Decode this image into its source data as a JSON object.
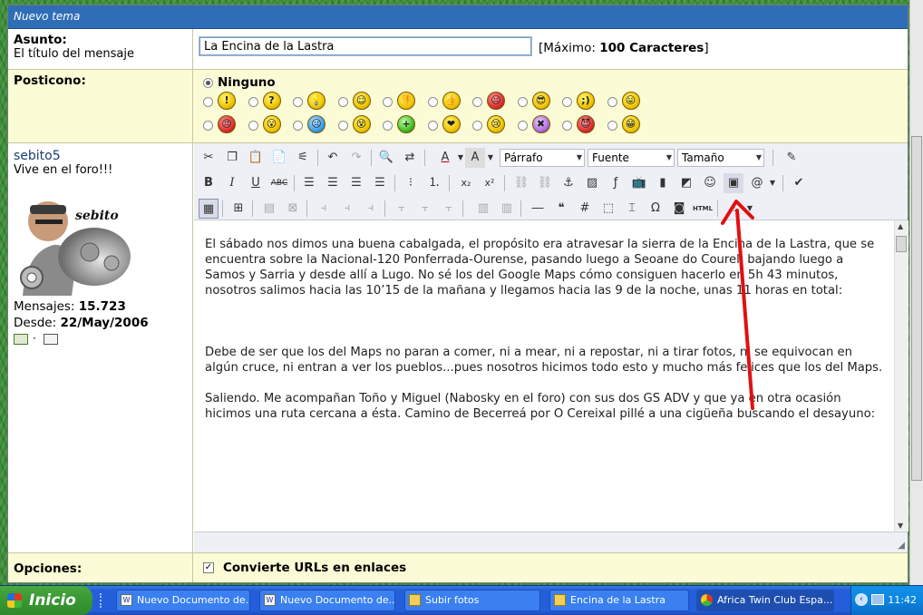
{
  "panel": {
    "title": "Nuevo tema"
  },
  "subject": {
    "label": "Asunto:",
    "sublabel": "El título del mensaje",
    "value": "La Encina de la Lastra",
    "max_prefix": "[Máximo: ",
    "max_bold": "100 Caracteres",
    "max_suffix": "]"
  },
  "posticon": {
    "label": "Posticono:",
    "none_label": "Ninguno",
    "row1": [
      "!",
      "?",
      "💡",
      "☺",
      "👎",
      "👍",
      "☹",
      "😎",
      ";)",
      "😛"
    ],
    "row2": [
      "😠",
      "😮",
      "☹",
      "😵",
      "+",
      "❤",
      "😢",
      "✖",
      "😈",
      "😁"
    ]
  },
  "user": {
    "name": "sebito5",
    "status": "Vive en el foro!!!",
    "avatar_caption": "sebito",
    "posts_label": "Mensajes: ",
    "posts_value": "15.723",
    "since_label": "Desde: ",
    "since_value": "22/May/2006",
    "separator": "·"
  },
  "toolbar": {
    "format_label": "Párrafo",
    "font_label": "Fuente",
    "size_label": "Tamaño",
    "bold": "B",
    "italic": "I",
    "underline": "U",
    "strike": "ABC",
    "html": "HTML",
    "hash": "#",
    "omega": "Ω",
    "at": "@"
  },
  "editor": {
    "paragraphs": [
      "El sábado nos dimos una buena cabalgada, el propósito era atravesar la sierra de la Encina de la Lastra, que se encuentra sobre la Nacional-120 Ponferrada-Ourense, pasando luego a Seoane do Courel, bajando luego a Samos y Sarria y desde allí a Lugo. No sé los del Google Maps cómo consiguen hacerlo en 5h 43 minutos, nosotros salimos hacia las 10’15 de la mañana y llegamos hacia las 9 de la noche, unas 11 horas en total:",
      "Debe de ser que los del Maps no paran a comer, ni a mear, ni a repostar, ni a tirar fotos, ni se equivocan en algún cruce, ni entran a ver los pueblos...pues nosotros hicimos todo esto y mucho más felices que los del Maps.",
      "Saliendo. Me acompañan Toño y Miguel (Nabosky en el foro) con sus dos GS ADV y que ya en otra ocasión hicimos una ruta cercana a ésta. Camino de Becerreá por O Cereixal pillé a una cigüeña buscando el desayuno:"
    ]
  },
  "options": {
    "label": "Opciones:",
    "convert_urls": "Convierte URLs en enlaces"
  },
  "taskbar": {
    "start": "Inicio",
    "tasks": [
      "Nuevo Documento de...",
      "Nuevo Documento de...",
      "Subir fotos",
      "Encina de la Lastra",
      "Africa Twin Club Espa..."
    ],
    "clock": "11:42"
  },
  "colors": {
    "header": "#2f6db6",
    "highlight_row": "#fbfbd6",
    "annotation_arrow": "#e01010"
  }
}
